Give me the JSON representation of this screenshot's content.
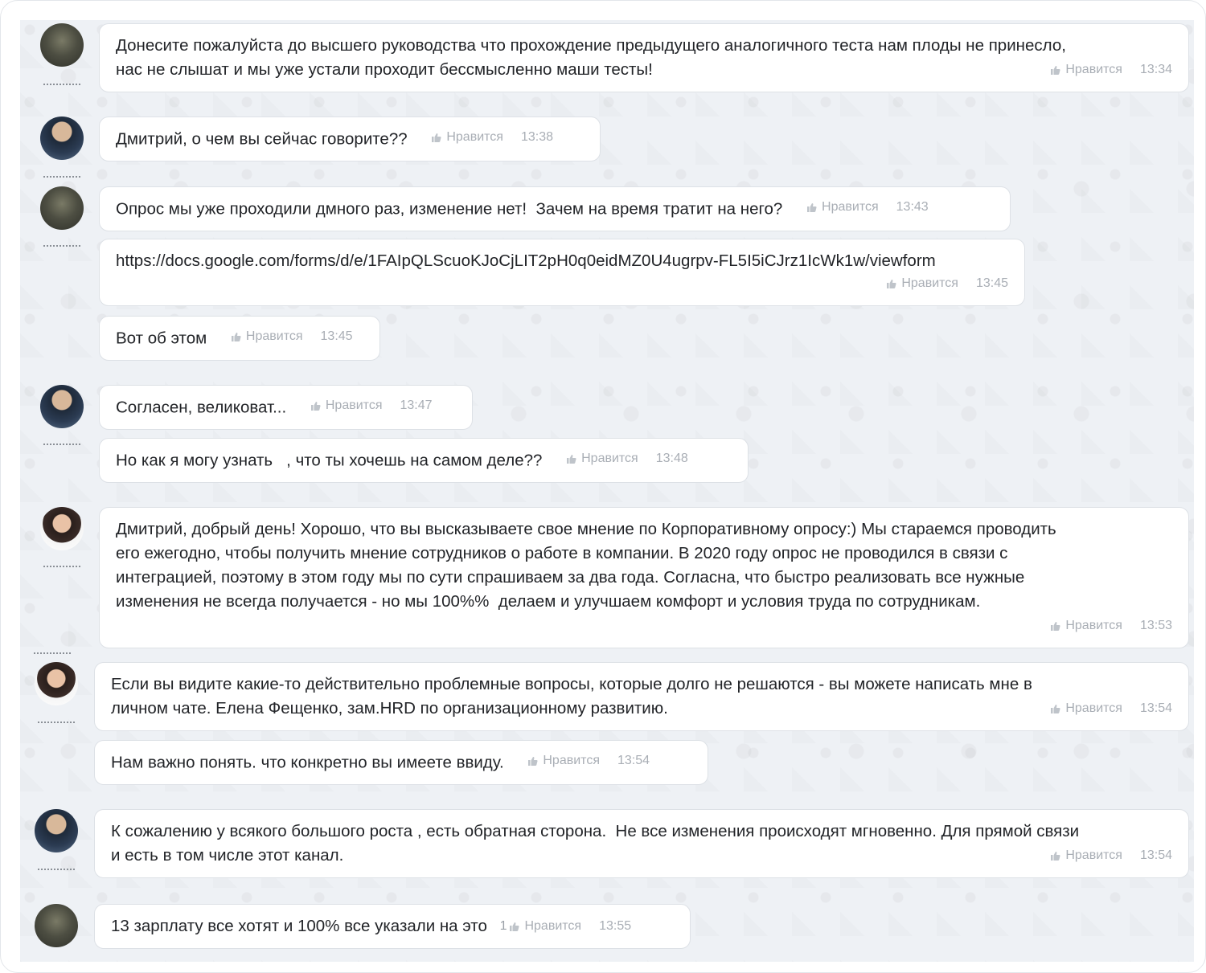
{
  "like_label": "Нравится",
  "messages": [
    {
      "text": "Донесите пожалуйста до высшего руководства что прохождение предыдущего аналогичного теста нам плоды не принесло,\nнас не слышат и мы уже устали проходит бессмысленно маши тесты!",
      "time": "13:34"
    },
    {
      "text": "Дмитрий, о чем вы сейчас говорите??",
      "time": "13:38"
    },
    {
      "text": "Опрос мы уже проходили дмного раз, изменение нет!  Зачем на время тратит на него?",
      "time": "13:43"
    },
    {
      "text": "https://docs.google.com/forms/d/e/1FAIpQLScuoKJoCjLIT2pH0q0eidMZ0U4ugrpv-FL5I5iCJrz1IcWk1w/viewform",
      "time": "13:45"
    },
    {
      "text": "Вот об этом",
      "time": "13:45"
    },
    {
      "text": "Согласен, великоват...",
      "time": "13:47"
    },
    {
      "text": "Но как я могу узнать   , что ты хочешь на самом деле??",
      "time": "13:48"
    },
    {
      "text": "Дмитрий, добрый день! Хорошо, что вы высказываете свое мнение по Корпоративному опросу:) Мы стараемся проводить\nего ежегодно, чтобы получить мнение сотрудников о работе в компании. В 2020 году опрос не проводился в связи с\nинтеграцией, поэтому в этом году мы по сути спрашиваем за два года. Согласна, что быстро реализовать все нужные\nизменения не всегда получается - но мы 100%%  делаем и улучшаем комфорт и условия труда по сотрудникам.",
      "time": "13:53"
    },
    {
      "text": "Если вы видите какие-то действительно проблемные вопросы, которые долго не решаются - вы можете написать мне в\nличном чате. Елена Фещенко, зам.HRD по организационному развитию.",
      "time": "13:54"
    },
    {
      "text": "Нам важно понять. что конкретно вы имеете ввиду.",
      "time": "13:54"
    },
    {
      "text": "К сожалению у всякого большого роста , есть обратная сторона.  Не все изменения происходят мгновенно. Для прямой связи\nи есть в том числе этот канал.",
      "time": "13:54"
    },
    {
      "text": "13 зарплату все хотят и 100% все указали на это",
      "time": "13:55",
      "likes": "1"
    }
  ]
}
